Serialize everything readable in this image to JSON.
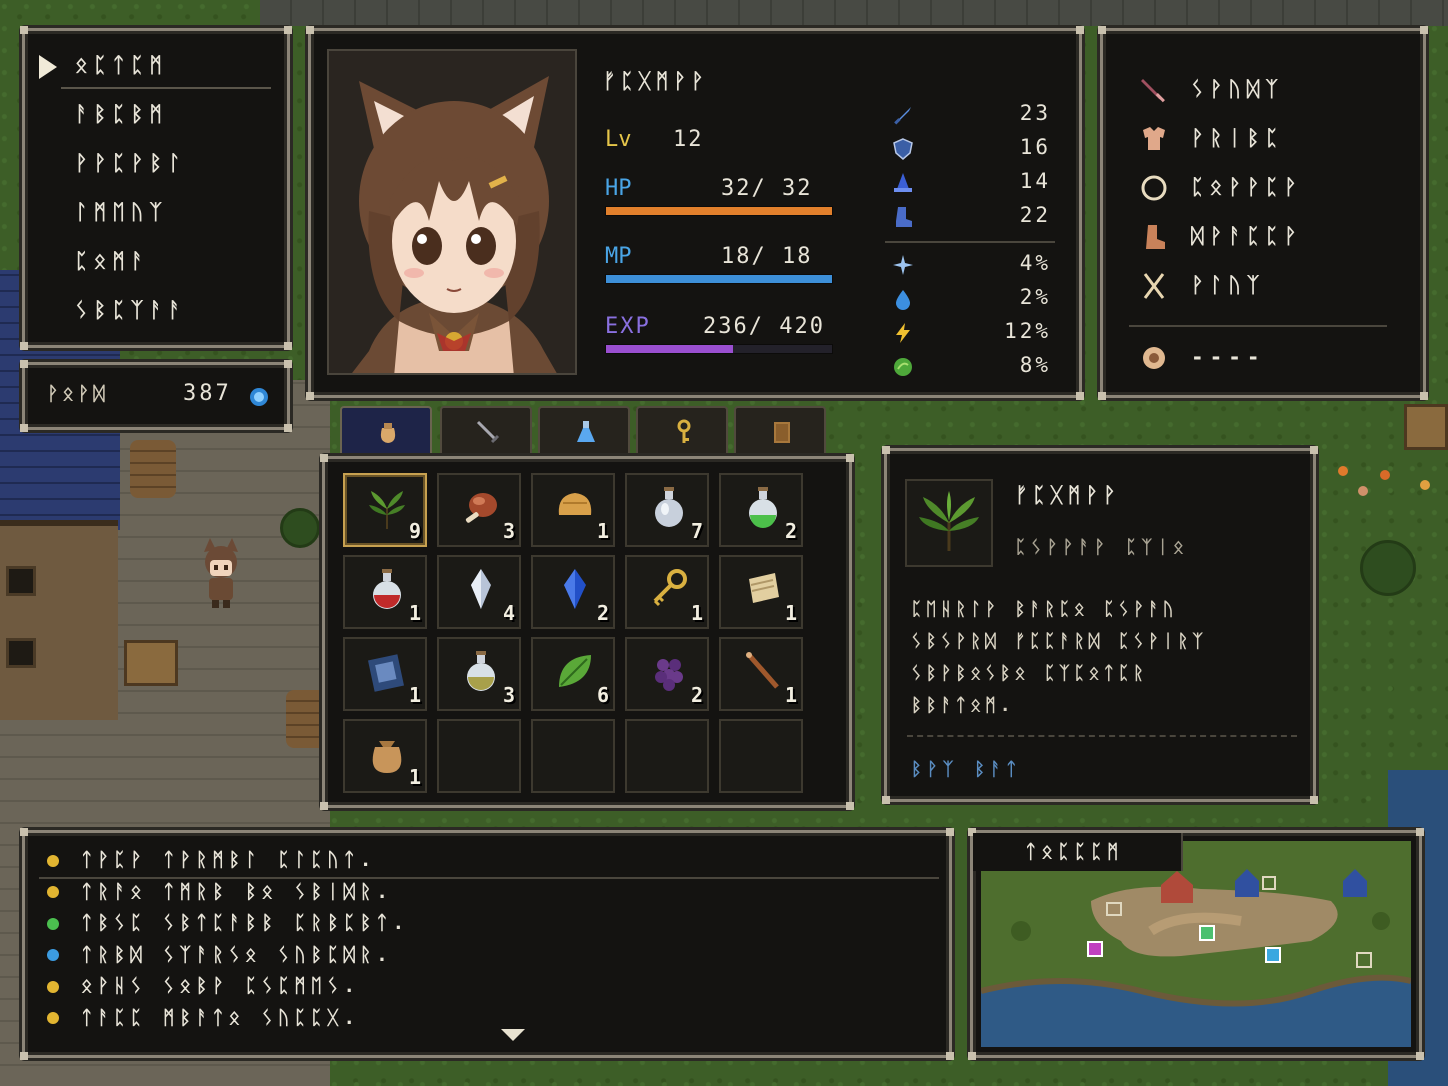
{
  "menu": {
    "items": [
      {
        "label": "ᛟᛈᛏᛈᛗ"
      },
      {
        "label": "ᚨᛒᛈᛒᛗ"
      },
      {
        "label": "ᚹᚹᛈᚹᛒᛚ"
      },
      {
        "label": "ᛚᛗᛖᚢᛉ"
      },
      {
        "label": "ᛈᛟᛗᚨ"
      },
      {
        "label": "ᛊᛒᛈᛉᚨᚨ"
      }
    ],
    "selected_index": 0
  },
  "gold": {
    "label": "ᚹᛟᚹᛞ",
    "value": "387",
    "icon": "gold-coin-icon"
  },
  "character": {
    "name": "ᚠᛈᚷᛗᚹᚹ",
    "level_label": "Lv",
    "level": "12",
    "hp_label": "HP",
    "hp_text": "32/ 32",
    "hp_fraction": 1.0,
    "mp_label": "MP",
    "mp_text": "18/ 18",
    "mp_fraction": 1.0,
    "exp_label": "EXP",
    "exp_text": "236/ 420",
    "exp_fraction": 0.5619,
    "colors": {
      "hp": "#e2802c",
      "mp": "#3d8fd8",
      "exp": "#9a4fd0"
    }
  },
  "stats": [
    {
      "icon": "sword-icon",
      "value": "23"
    },
    {
      "icon": "shield-icon",
      "value": "16"
    },
    {
      "icon": "magic-hat-icon",
      "value": "14"
    },
    {
      "icon": "boot-icon",
      "value": "22"
    }
  ],
  "resistances": [
    {
      "icon": "sparkle-icon",
      "value": "4%"
    },
    {
      "icon": "water-drop-icon",
      "value": "2%"
    },
    {
      "icon": "lightning-icon",
      "value": "12%"
    },
    {
      "icon": "leaf-orb-icon",
      "value": "8%"
    }
  ],
  "equipment": [
    {
      "icon": "sword-icon",
      "label": "ᛊᚹᚢᛞᛉ"
    },
    {
      "icon": "armor-icon",
      "label": "ᚹᚱᛁᛒᛈ"
    },
    {
      "icon": "ring-icon",
      "label": "ᛈᛟᚹᚹᛈᚹ"
    },
    {
      "icon": "boots-icon",
      "label": "ᛞᚹᚨᛈᛈᚹ"
    },
    {
      "icon": "amulet-icon",
      "label": "ᚹᛚᚢᛉ"
    },
    {
      "icon": "crest-icon",
      "label": "----"
    }
  ],
  "tabs": [
    {
      "icon": "bag-icon",
      "active": true
    },
    {
      "icon": "sword-icon",
      "active": false
    },
    {
      "icon": "potion-icon",
      "active": false
    },
    {
      "icon": "key-icon",
      "active": false
    },
    {
      "icon": "book-icon",
      "active": false
    }
  ],
  "inventory": [
    {
      "icon": "herb-icon",
      "count": "9",
      "selected": true
    },
    {
      "icon": "meat-icon",
      "count": "3"
    },
    {
      "icon": "bread-icon",
      "count": "1"
    },
    {
      "icon": "empty-flask-icon",
      "count": "7"
    },
    {
      "icon": "green-potion-icon",
      "count": "2"
    },
    {
      "icon": "red-potion-icon",
      "count": "1"
    },
    {
      "icon": "crystal-icon",
      "count": "4"
    },
    {
      "icon": "blue-gem-icon",
      "count": "2"
    },
    {
      "icon": "gold-key-icon",
      "count": "1"
    },
    {
      "icon": "scroll-icon",
      "count": "1"
    },
    {
      "icon": "spellbook-icon",
      "count": "1"
    },
    {
      "icon": "yellow-potion-icon",
      "count": "3"
    },
    {
      "icon": "leaf-icon",
      "count": "6"
    },
    {
      "icon": "grapes-icon",
      "count": "2"
    },
    {
      "icon": "wand-icon",
      "count": "1"
    },
    {
      "icon": "pouch-icon",
      "count": "1"
    },
    {
      "icon": "",
      "count": ""
    },
    {
      "icon": "",
      "count": ""
    },
    {
      "icon": "",
      "count": ""
    },
    {
      "icon": "",
      "count": ""
    }
  ],
  "detail": {
    "icon": "herb-icon",
    "name": "ᚠᛈᚷᛗᚹᚹ",
    "subtitle": "ᛈᛊᚹᚹᚨᚹ ᛈᛉᛁᛟ",
    "lines": [
      "ᛈᛖᚺᚱᛚᚹ ᛒᚨᚱᛈᛟ ᛈᛊᚹᚨᚢ",
      "ᛊᛒᛊᚹᚱᛞ ᚠᛈᛈᚨᚱᛞ ᛈᛊᚹᛁᚱᛉ",
      "ᛊᛒᚹᛒᛟᛊᛒᛟ ᛈᛉᛈᛟᛏᛈᚱ",
      "ᛒᛒᚨᛏᛟᛗ."
    ],
    "footer": "ᛒᚹᛉ ᛒᚨᛏ"
  },
  "log": [
    {
      "text": "ᛏᚹᛈᚹ ᛏᚹᚱᛗᛒᛚ ᛈᛚᛈᚢᛏ.",
      "color": "#e2b531"
    },
    {
      "text": "ᛏᚱᚨᛟ ᛏᛗᚱᛒ ᛒᛟ ᛊᛒᛁᛞᚱ.",
      "color": "#e2b531"
    },
    {
      "text": "ᛏᛒᛊᛈ ᛊᛒᛏᛈᚨᛒᛒ ᛈᚱᛒᛈᛒᛏ.",
      "color": "#4bbf4f"
    },
    {
      "text": "ᛏᚱᛒᛞ ᛊᛉᚨᚱᛊᛟ ᛊᚢᛒᛈᛞᚱ.",
      "color": "#3c9be0"
    },
    {
      "text": "ᛟᚹᚺᛊ ᛊᛟᛒᚹ ᛈᛊᛈᛗᛖᛊ.",
      "color": "#e2b531"
    },
    {
      "text": "ᛏᚨᛈᛈ ᛗᛒᚨᛏᛟ ᛊᚢᛈᛈᚷ.",
      "color": "#e2b531"
    }
  ],
  "minimap": {
    "title": "ᛏᛟᛈᛈᛈᛗ",
    "markers": [
      {
        "icon": "player-marker-icon",
        "color": "#c040c0"
      },
      {
        "icon": "quest-marker-icon",
        "color": "#4cc070"
      },
      {
        "icon": "shop-marker-icon",
        "color": "#3aa8e0"
      }
    ]
  }
}
